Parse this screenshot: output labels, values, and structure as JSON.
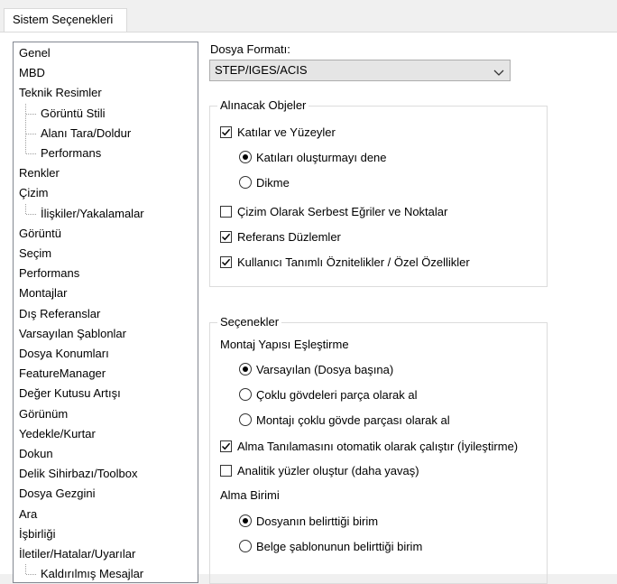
{
  "tab": {
    "label": "Sistem Seçenekleri"
  },
  "tree": {
    "items": [
      {
        "label": "Genel",
        "level": 0
      },
      {
        "label": "MBD",
        "level": 0
      },
      {
        "label": "Teknik Resimler",
        "level": 0
      },
      {
        "label": "Görüntü Stili",
        "level": 1
      },
      {
        "label": "Alanı Tara/Doldur",
        "level": 1
      },
      {
        "label": "Performans",
        "level": 1
      },
      {
        "label": "Renkler",
        "level": 0
      },
      {
        "label": "Çizim",
        "level": 0
      },
      {
        "label": "İlişkiler/Yakalamalar",
        "level": 1
      },
      {
        "label": "Görüntü",
        "level": 0
      },
      {
        "label": "Seçim",
        "level": 0
      },
      {
        "label": "Performans",
        "level": 0
      },
      {
        "label": "Montajlar",
        "level": 0
      },
      {
        "label": "Dış Referanslar",
        "level": 0
      },
      {
        "label": "Varsayılan Şablonlar",
        "level": 0
      },
      {
        "label": "Dosya Konumları",
        "level": 0
      },
      {
        "label": "FeatureManager",
        "level": 0
      },
      {
        "label": "Değer Kutusu Artışı",
        "level": 0
      },
      {
        "label": "Görünüm",
        "level": 0
      },
      {
        "label": "Yedekle/Kurtar",
        "level": 0
      },
      {
        "label": "Dokun",
        "level": 0
      },
      {
        "label": "Delik Sihirbazı/Toolbox",
        "level": 0
      },
      {
        "label": "Dosya Gezgini",
        "level": 0
      },
      {
        "label": "Ara",
        "level": 0
      },
      {
        "label": "İşbirliği",
        "level": 0
      },
      {
        "label": "İletiler/Hatalar/Uyarılar",
        "level": 0
      },
      {
        "label": "Kaldırılmış Mesajlar",
        "level": 1
      }
    ]
  },
  "file_format": {
    "label": "Dosya Formatı:",
    "selected": "STEP/IGES/ACIS",
    "icon": "chevron-down-icon"
  },
  "objects_group": {
    "title": "Alınacak Objeler",
    "solids_surfaces": {
      "label": "Katılar ve Yüzeyler",
      "checked": true
    },
    "try_form_solids": {
      "label": "Katıları oluşturmayı dene",
      "selected": true
    },
    "knit": {
      "label": "Dikme",
      "selected": false
    },
    "free_curves": {
      "label": "Çizim Olarak Serbest Eğriler ve Noktalar",
      "checked": false
    },
    "ref_planes": {
      "label": "Referans Düzlemler",
      "checked": true
    },
    "user_attributes": {
      "label": "Kullanıcı Tanımlı Öznitelikler / Özel Özellikler",
      "checked": true
    }
  },
  "options_group": {
    "title": "Seçenekler",
    "assembly_mapping_label": "Montaj Yapısı Eşleştirme",
    "default_per_file": {
      "label": "Varsayılan (Dosya başına)",
      "selected": true
    },
    "multibody_as_part": {
      "label": "Çoklu gövdeleri parça olarak al",
      "selected": false
    },
    "assembly_as_multibody": {
      "label": "Montajı çoklu gövde parçası olarak al",
      "selected": false
    },
    "auto_diagnose": {
      "label": "Alma Tanılamasını otomatik olarak çalıştır (İyileştirme)",
      "checked": true
    },
    "analytic_faces": {
      "label": "Analitik yüzler oluştur (daha yavaş)",
      "checked": false
    },
    "import_unit_label": "Alma Birimi",
    "file_unit": {
      "label": "Dosyanın belirttiği birim",
      "selected": true
    },
    "template_unit": {
      "label": "Belge şablonunun belirttiği birim",
      "selected": false
    }
  }
}
